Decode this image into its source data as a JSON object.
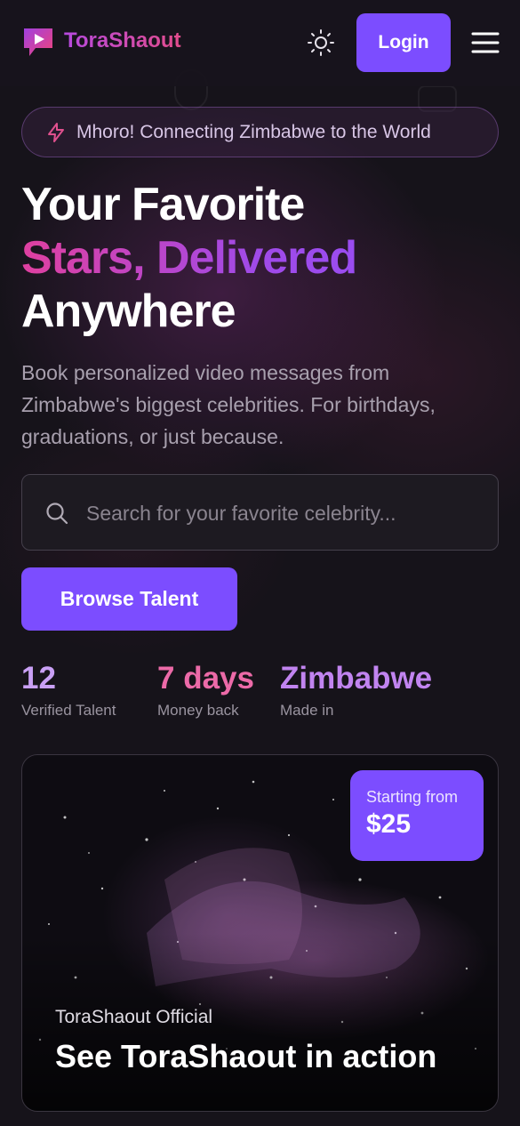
{
  "header": {
    "brand": "ToraShaout",
    "login_label": "Login",
    "icons": {
      "logo": "play-logo-icon",
      "theme": "sun-icon",
      "menu": "hamburger-menu-icon"
    }
  },
  "announcement": {
    "text": "Mhoro! Connecting Zimbabwe to the World",
    "icon": "lightning-bolt-icon"
  },
  "hero": {
    "title_line1": "Your Favorite",
    "title_accent": "Stars, Delivered",
    "title_line3": "Anywhere",
    "subtitle": "Book personalized video messages from Zimbabwe's biggest celebrities. For birthdays, graduations, or just because."
  },
  "search": {
    "placeholder": "Search for your favorite celebrity...",
    "value": "",
    "icon": "search-icon"
  },
  "cta": {
    "browse_label": "Browse Talent"
  },
  "stats": [
    {
      "value": "12",
      "label": "Verified Talent",
      "color": "#c9a0f5"
    },
    {
      "value": "7 days",
      "label": "Money back",
      "color": "#ec6aa8"
    },
    {
      "value": "Zimbabwe",
      "label": "Made in",
      "color": "#c184f0"
    }
  ],
  "video": {
    "price_label": "Starting from",
    "price_value": "$25",
    "source": "ToraShaout Official",
    "title": "See ToraShaout in action"
  },
  "colors": {
    "accent": "#7c4dff",
    "background": "#16131a",
    "brand_gradient_start": "#b74ae0",
    "brand_gradient_end": "#e24c8c"
  }
}
